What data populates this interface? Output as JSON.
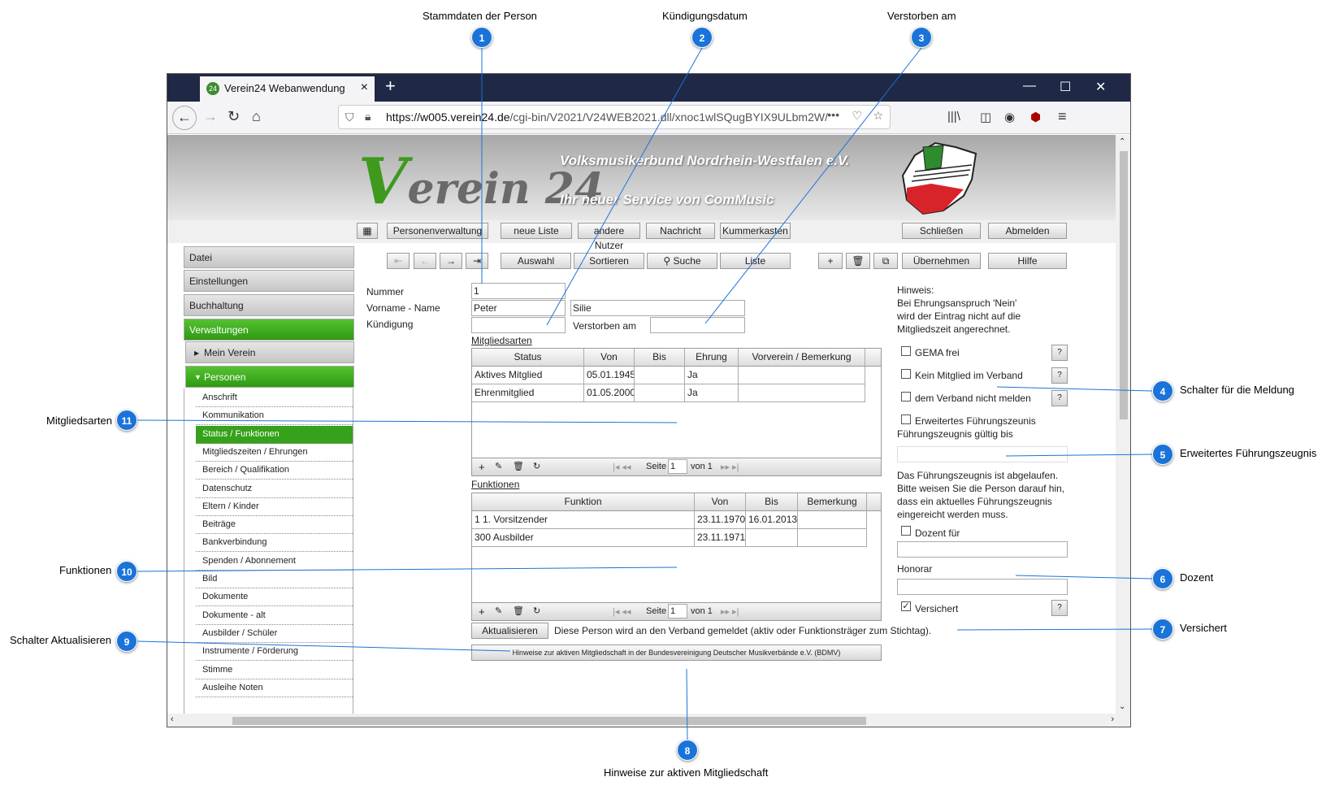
{
  "browser": {
    "tab_title": "Verein24 Webanwendung",
    "tab_favicon": "24",
    "url_host": "https://w005.verein24.de",
    "url_path": "/cgi-bin/V2021/V24WEB2021.dll/xnoc1wlSQugBYIX9ULbm2W/"
  },
  "banner": {
    "logo_v": "V",
    "logo_rest": "erein 24",
    "title": "Volksmusikerbund Nordrhein-Westfalen e.V.",
    "subtitle": "Ihr neuer Service von ComMusic"
  },
  "topmenu": [
    "Personenverwaltung",
    "neue Liste",
    "andere Nutzer",
    "Nachricht",
    "Kummerkasten",
    "Schließen",
    "Abmelden"
  ],
  "toolbar": {
    "auswahl": "Auswahl",
    "sortieren": "Sortieren",
    "suche": "Suche",
    "liste": "Liste",
    "uebernehmen": "Übernehmen",
    "hilfe": "Hilfe"
  },
  "sidebar": {
    "main": [
      "Datei",
      "Einstellungen",
      "Buchhaltung",
      "Verwaltungen"
    ],
    "mein_verein": "Mein Verein",
    "personen": "Personen",
    "sub": [
      "Anschrift",
      "Kommunikation",
      "Status / Funktionen",
      "Mitgliedszeiten / Ehrungen",
      "Bereich / Qualifikation",
      "Datenschutz",
      "Eltern / Kinder",
      "Beiträge",
      "Bankverbindung",
      "Spenden / Abonnement",
      "Bild",
      "Dokumente",
      "Dokumente - alt",
      "Ausbilder / Schüler",
      "Instrumente / Förderung",
      "Stimme",
      "Ausleihe Noten"
    ]
  },
  "form": {
    "nummer_label": "Nummer",
    "nummer": "1",
    "name_label": "Vorname - Name",
    "vorname": "Peter",
    "nachname": "Silie",
    "kuendigung_label": "Kündigung",
    "verstorben_label": "Verstorben am"
  },
  "mitgliedsarten": {
    "title": "Mitgliedsarten",
    "headers": [
      "Status",
      "Von",
      "Bis",
      "Ehrung",
      "Vorverein / Bemerkung"
    ],
    "rows": [
      [
        "Aktives Mitglied",
        "05.01.1945",
        "",
        "Ja",
        ""
      ],
      [
        "Ehrenmitglied",
        "01.05.2000",
        "",
        "Ja",
        ""
      ]
    ],
    "seite": "Seite",
    "page": "1",
    "von": "von 1"
  },
  "funktionen": {
    "title": "Funktionen",
    "headers": [
      "Funktion",
      "Von",
      "Bis",
      "Bemerkung"
    ],
    "rows": [
      [
        "1 1. Vorsitzender",
        "23.11.1970",
        "16.01.2013",
        ""
      ],
      [
        "300 Ausbilder",
        "23.11.1971",
        "",
        ""
      ]
    ],
    "seite": "Seite",
    "page": "1",
    "von": "von 1"
  },
  "actions": {
    "aktualisieren": "Aktualisieren",
    "info": "Diese Person wird an den Verband gemeldet (aktiv oder Funktionsträger zum Stichtag).",
    "hinweise": "Hinweise zur aktiven Mitgliedschaft in der Bundesvereinigung Deutscher Musikverbände e.V. (BDMV)"
  },
  "right": {
    "hinweis": "Hinweis:",
    "hinweis_text": [
      "Bei Ehrungsanspruch 'Nein'",
      "wird der Eintrag nicht auf die",
      "Mitgliedszeit angerechnet."
    ],
    "gema": "GEMA frei",
    "kein_mitglied": "Kein Mitglied im Verband",
    "nicht_melden": "dem Verband nicht melden",
    "fuehrung": "Erweitertes Führungszeunis",
    "fuehrung_gueltig": "Führungszeugnis gültig bis",
    "abgelaufen": [
      "Das Führungszeugnis ist abgelaufen.",
      "Bitte weisen Sie die Person darauf hin,",
      "dass ein aktuelles Führungszeugnis",
      "eingereicht werden muss."
    ],
    "dozent": "Dozent für",
    "honorar": "Honorar",
    "versichert": "Versichert",
    "q": "?"
  },
  "annotations": [
    {
      "n": "1",
      "text": "Stammdaten der Person"
    },
    {
      "n": "2",
      "text": "Kündigungsdatum"
    },
    {
      "n": "3",
      "text": "Verstorben am"
    },
    {
      "n": "4",
      "text": "Schalter für die Meldung"
    },
    {
      "n": "5",
      "text": "Erweitertes Führungszeugnis"
    },
    {
      "n": "6",
      "text": "Dozent"
    },
    {
      "n": "7",
      "text": "Versichert"
    },
    {
      "n": "8",
      "text": "Hinweise zur aktiven Mitgliedschaft"
    },
    {
      "n": "9",
      "text": "Schalter Aktualisieren"
    },
    {
      "n": "10",
      "text": "Funktionen"
    },
    {
      "n": "11",
      "text": "Mitgliedsarten"
    }
  ]
}
